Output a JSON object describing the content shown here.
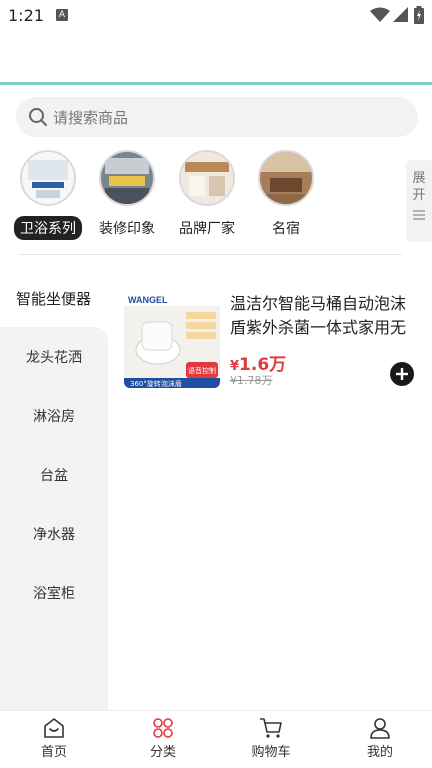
{
  "status_bar": {
    "time": "1:21",
    "notification_icon_letter": "A"
  },
  "search": {
    "placeholder": "请搜索商品"
  },
  "categories": [
    {
      "label": "卫浴系列",
      "active": true
    },
    {
      "label": "装修印象",
      "active": false
    },
    {
      "label": "品牌厂家",
      "active": false
    },
    {
      "label": "名宿",
      "active": false
    }
  ],
  "expand_tab": {
    "label": "展开"
  },
  "sidebar": {
    "active": "智能坐便器",
    "items": [
      "龙头花洒",
      "淋浴房",
      "台盆",
      "净水器",
      "浴室柜"
    ]
  },
  "product": {
    "title": "温洁尔智能马桶自动泡沫盾紫外杀菌一体式家用无水压限制",
    "price_symbol": "¥",
    "price": "1.6万",
    "original_price": "¥1.78万",
    "image_brand": "WANGEL",
    "image_banner": "360°旋转泡沫盾",
    "image_badge": "语音控制"
  },
  "bottom_nav": [
    {
      "label": "首页",
      "icon": "home-icon"
    },
    {
      "label": "分类",
      "icon": "category-icon"
    },
    {
      "label": "购物车",
      "icon": "cart-icon"
    },
    {
      "label": "我的",
      "icon": "user-icon"
    }
  ],
  "colors": {
    "accent": "#e0393e",
    "header_line": "#7fd1c3",
    "category_active_bg": "#222222"
  }
}
